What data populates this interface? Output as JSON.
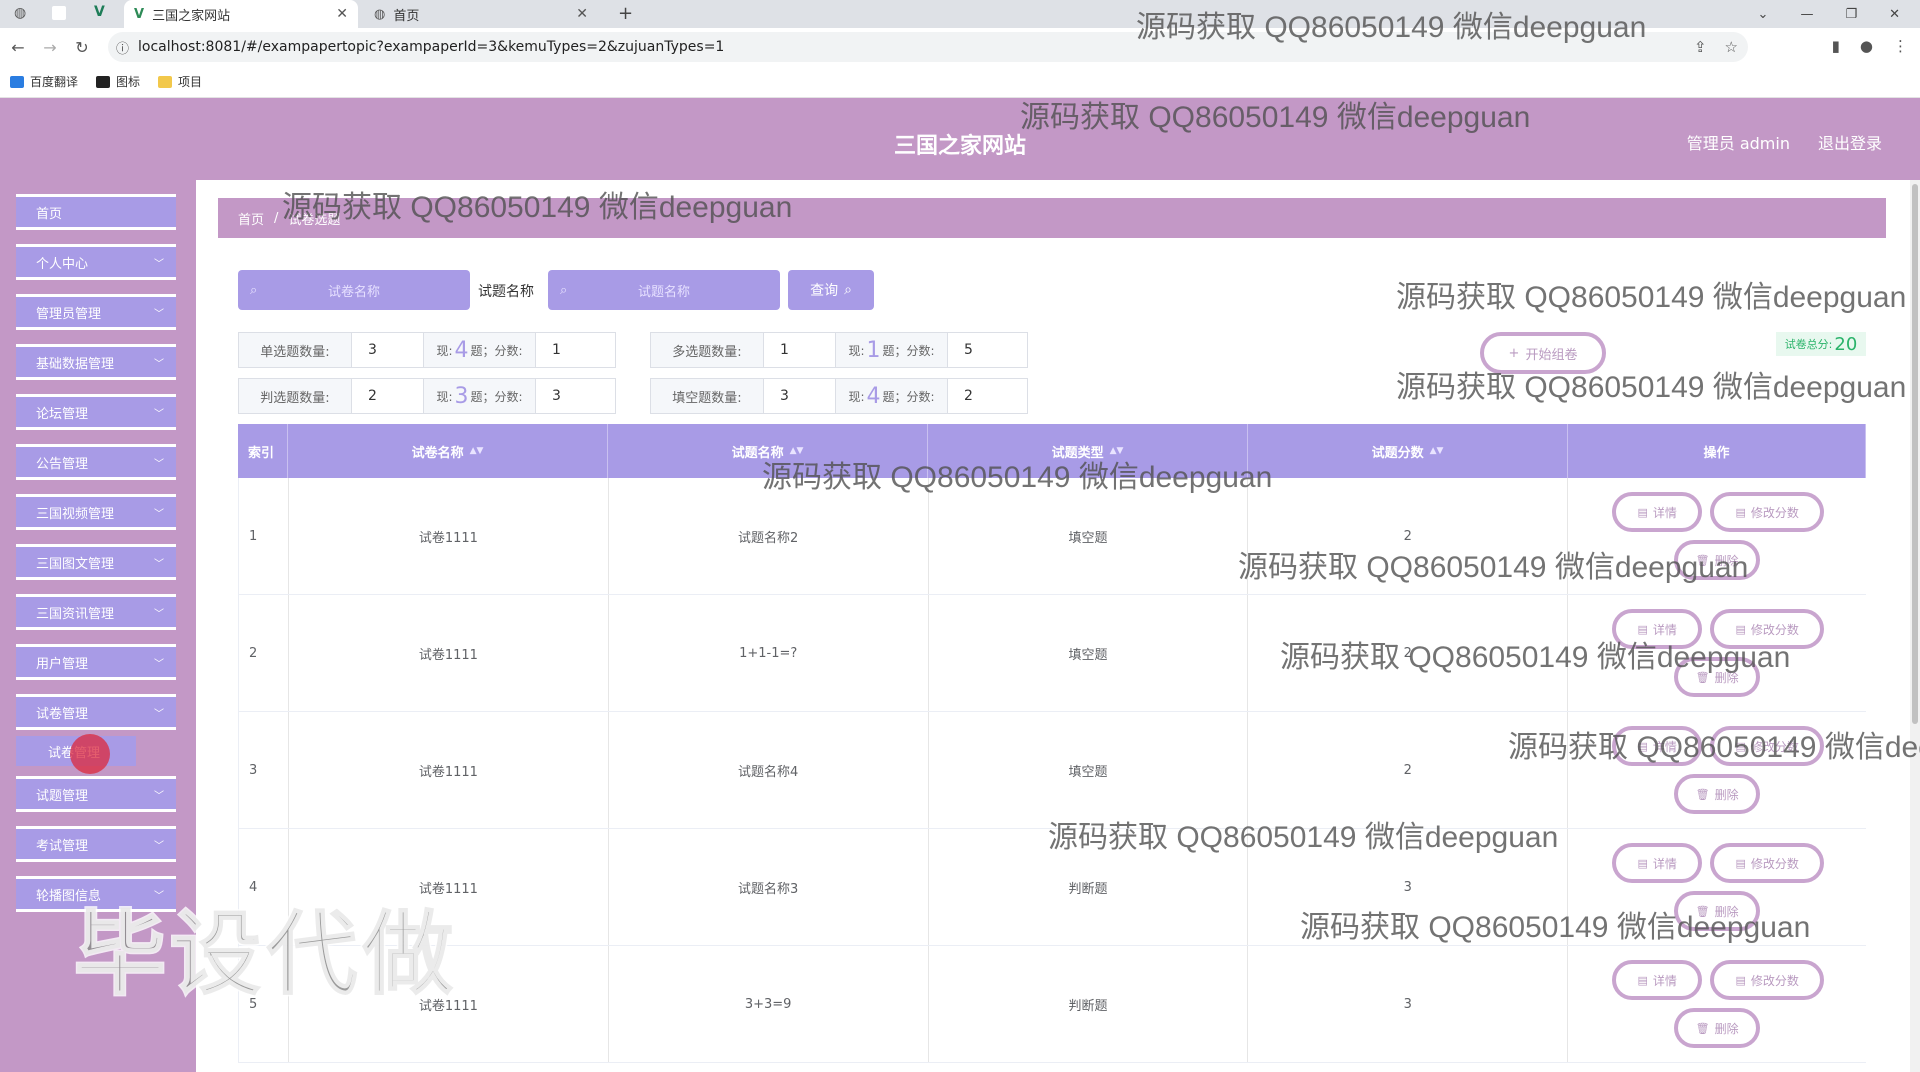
{
  "browser": {
    "tabs": [
      {
        "label": "三国之家网站",
        "active": true
      },
      {
        "label": "首页",
        "active": false
      }
    ],
    "url": "localhost:8081/#/exampapertopic?exampaperId=3&kemuTypes=2&zujuanTypes=1",
    "bookmarks": [
      "百度翻译",
      "图标",
      "项目"
    ]
  },
  "header": {
    "title": "三国之家网站",
    "admin": "管理员 admin",
    "logout": "退出登录"
  },
  "sidebar": {
    "items": [
      {
        "label": "首页",
        "chevron": false
      },
      {
        "label": "个人中心",
        "chevron": true
      },
      {
        "label": "管理员管理",
        "chevron": true
      },
      {
        "label": "基础数据管理",
        "chevron": true
      },
      {
        "label": "论坛管理",
        "chevron": true
      },
      {
        "label": "公告管理",
        "chevron": true
      },
      {
        "label": "三国视频管理",
        "chevron": true
      },
      {
        "label": "三国图文管理",
        "chevron": true
      },
      {
        "label": "三国资讯管理",
        "chevron": true
      },
      {
        "label": "用户管理",
        "chevron": true
      },
      {
        "label": "试卷管理",
        "chevron": true
      },
      {
        "label": "试题管理",
        "chevron": true
      },
      {
        "label": "考试管理",
        "chevron": true
      },
      {
        "label": "轮播图信息",
        "chevron": true
      }
    ],
    "subitem": "试卷管理"
  },
  "breadcrumb": {
    "home": "首页",
    "current": "试卷选题"
  },
  "search": {
    "paper_placeholder": "试卷名称",
    "topic_label": "试题名称",
    "topic_placeholder": "试题名称",
    "query_label": "查询"
  },
  "stats": {
    "now_prefix": "现:",
    "now_suffix": "题；分数:",
    "groups": [
      {
        "label": "单选题数量:",
        "value": "3",
        "now": "4",
        "score": "1"
      },
      {
        "label": "多选题数量:",
        "value": "1",
        "now": "1",
        "score": "5"
      },
      {
        "label": "判选题数量:",
        "value": "2",
        "now": "3",
        "score": "3"
      },
      {
        "label": "填空题数量:",
        "value": "3",
        "now": "4",
        "score": "2"
      }
    ]
  },
  "start_button": "开始组卷",
  "total": {
    "label": "试卷总分:",
    "value": "20"
  },
  "table": {
    "headers": [
      "索引",
      "试卷名称",
      "试题名称",
      "试题类型",
      "试题分数",
      "操作"
    ],
    "actions": {
      "detail": "详情",
      "edit": "修改分数",
      "delete": "删除"
    },
    "rows": [
      {
        "index": "1",
        "paper": "试卷1111",
        "topic": "试题名称2",
        "type": "填空题",
        "score": "2"
      },
      {
        "index": "2",
        "paper": "试卷1111",
        "topic": "1+1-1=?",
        "type": "填空题",
        "score": "2"
      },
      {
        "index": "3",
        "paper": "试卷1111",
        "topic": "试题名称4",
        "type": "填空题",
        "score": "2"
      },
      {
        "index": "4",
        "paper": "试卷1111",
        "topic": "试题名称3",
        "type": "判断题",
        "score": "3"
      },
      {
        "index": "5",
        "paper": "试卷1111",
        "topic": "3+3=9",
        "type": "判断题",
        "score": "3"
      }
    ]
  },
  "watermark": "源码获取 QQ86050149 微信deepguan",
  "big_watermark": "毕设代做",
  "colors": {
    "primary": "#a89be6",
    "header": "#c398c6",
    "button_border": "#c9a5cf",
    "total": "#2ab36a"
  }
}
